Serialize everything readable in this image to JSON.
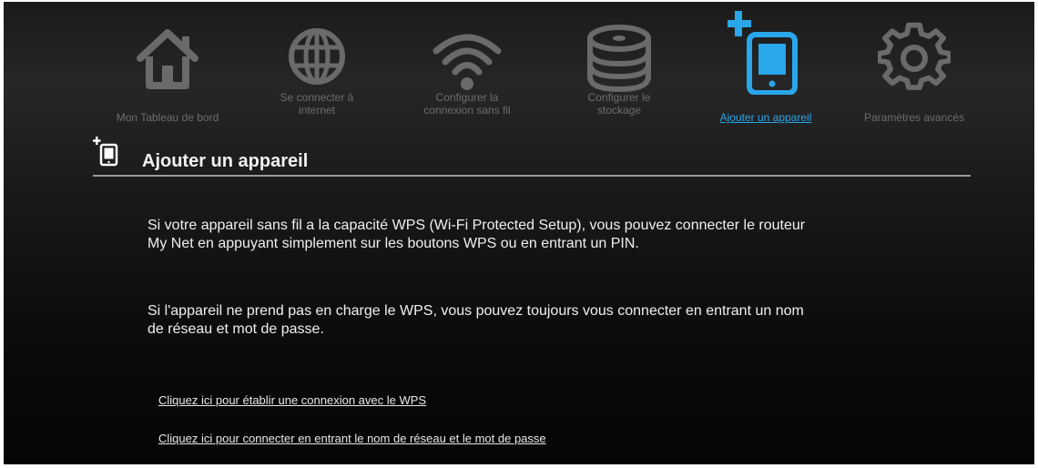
{
  "nav": {
    "items": [
      {
        "label_lines": [
          "Mon Tableau de bord"
        ],
        "icon": "home-icon",
        "active": false
      },
      {
        "label_lines": [
          "Se connecter à",
          "internet"
        ],
        "icon": "globe-icon",
        "active": false
      },
      {
        "label_lines": [
          "Configurer la",
          "connexion sans fil"
        ],
        "icon": "wifi-icon",
        "active": false
      },
      {
        "label_lines": [
          "Configurer le",
          "stockage"
        ],
        "icon": "storage-icon",
        "active": false
      },
      {
        "label_lines": [
          "Ajouter un appareil"
        ],
        "icon": "add-device-icon",
        "active": true
      },
      {
        "label_lines": [
          "Paramètres avancés"
        ],
        "icon": "gear-icon",
        "active": false
      }
    ]
  },
  "section": {
    "title": "Ajouter un appareil",
    "icon": "add-device-icon"
  },
  "content": {
    "paragraph1": "Si votre appareil sans fil a la capacité WPS (Wi-Fi Protected Setup), vous pouvez connecter le routeur My Net en appuyant simplement sur les boutons WPS ou en entrant un PIN.",
    "paragraph2": "Si l'appareil ne prend pas en charge le WPS, vous pouvez toujours vous connecter en entrant un nom de réseau et mot de passe.",
    "link_wps": "Cliquez ici pour établir une connexion avec le WPS",
    "link_password": "Cliquez ici pour connecter en entrant le nom de réseau et le mot de passe"
  },
  "colors": {
    "inactive_icon": "#6a6a6a",
    "active_accent": "#2aa6ea",
    "text": "#f0f0f0"
  }
}
